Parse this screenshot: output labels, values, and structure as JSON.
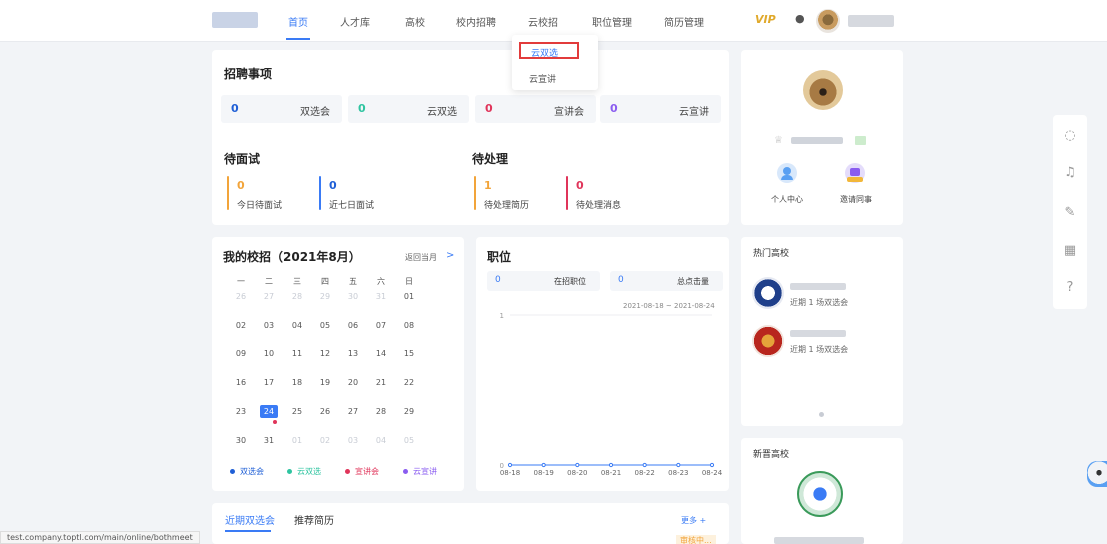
{
  "nav": {
    "items": [
      {
        "label": "首页",
        "active": true
      },
      {
        "label": "人才库"
      },
      {
        "label": "高校"
      },
      {
        "label": "校内招聘"
      },
      {
        "label": "云校招"
      },
      {
        "label": "职位管理"
      },
      {
        "label": "简历管理"
      }
    ],
    "vip": "VIP"
  },
  "dropdown": {
    "items": [
      "云双选",
      "云宣讲"
    ]
  },
  "recruit": {
    "title": "招聘事项",
    "stats": [
      {
        "value": "0",
        "label": "双选会",
        "color": "#1f5fd6"
      },
      {
        "value": "0",
        "label": "云双选",
        "color": "#2ec4a0"
      },
      {
        "value": "0",
        "label": "宣讲会",
        "color": "#e0345a"
      },
      {
        "value": "0",
        "label": "云宣讲",
        "color": "#8a5cf0"
      }
    ],
    "interview_title": "待面试",
    "interview": [
      {
        "value": "0",
        "label": "今日待面试",
        "color": "#f2a43a"
      },
      {
        "value": "0",
        "label": "近七日面试",
        "color": "#3a7bf5"
      }
    ],
    "pending_title": "待处理",
    "pending": [
      {
        "value": "1",
        "label": "待处理简历",
        "color": "#f2a43a"
      },
      {
        "value": "0",
        "label": "待处理消息",
        "color": "#e0345a"
      }
    ]
  },
  "profile": {
    "actions": [
      {
        "label": "个人中心",
        "icon": "user-icon",
        "color": "#5aa0f2"
      },
      {
        "label": "邀请同事",
        "icon": "invite-icon",
        "color": "#8a5cf0"
      }
    ]
  },
  "calendar": {
    "title": "我的校招（2021年8月）",
    "back": "返回当月",
    "next": ">",
    "weekdays": [
      "一",
      "二",
      "三",
      "四",
      "五",
      "六",
      "日"
    ],
    "days": [
      [
        "26",
        "27",
        "28",
        "29",
        "30",
        "31",
        "01"
      ],
      [
        "02",
        "03",
        "04",
        "05",
        "06",
        "07",
        "08"
      ],
      [
        "09",
        "10",
        "11",
        "12",
        "13",
        "14",
        "15"
      ],
      [
        "16",
        "17",
        "18",
        "19",
        "20",
        "21",
        "22"
      ],
      [
        "23",
        "24",
        "25",
        "26",
        "27",
        "28",
        "29"
      ],
      [
        "30",
        "31",
        "01",
        "02",
        "03",
        "04",
        "05"
      ]
    ],
    "today": "24",
    "legend": [
      {
        "label": "双选会",
        "color": "#1f5fd6"
      },
      {
        "label": "云双选",
        "color": "#2ec4a0"
      },
      {
        "label": "宣讲会",
        "color": "#e0345a"
      },
      {
        "label": "云宣讲",
        "color": "#8a5cf0"
      }
    ]
  },
  "positions": {
    "title": "职位",
    "stats": [
      {
        "value": "0",
        "label": "在招职位"
      },
      {
        "value": "0",
        "label": "总点击量"
      }
    ],
    "date_range": "2021-08-18 ~ 2021-08-24"
  },
  "chart_data": {
    "type": "line",
    "categories": [
      "08-18",
      "08-19",
      "08-20",
      "08-21",
      "08-22",
      "08-23",
      "08-24"
    ],
    "values": [
      0,
      0,
      0,
      0,
      0,
      0,
      0
    ],
    "ylim": [
      0,
      1
    ],
    "yticks": [
      "0",
      "1"
    ],
    "color": "#3a7bf5"
  },
  "hot": {
    "title": "热门高校",
    "items": [
      {
        "desc": "近期 1 场双选会"
      },
      {
        "desc": "近期 1 场双选会"
      }
    ]
  },
  "newcomer": {
    "title": "新晋高校"
  },
  "bottom_tabs": {
    "items": [
      "近期双选会",
      "推荐简历"
    ],
    "more": "更多 +",
    "badge": "审核中..."
  },
  "status_url": "test.company.toptl.com/main/online/bothmeet"
}
